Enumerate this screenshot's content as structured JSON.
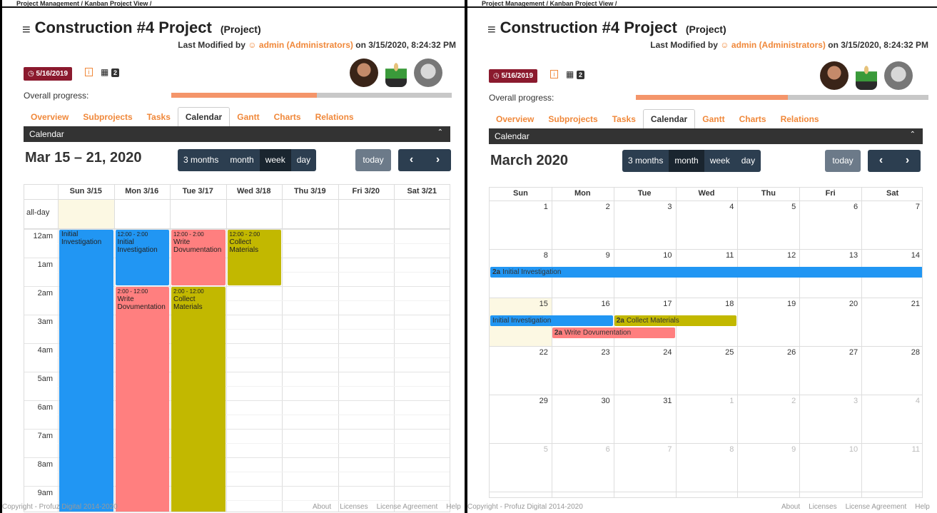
{
  "left": {
    "breadcrumb": "Project Management / Kanban Project View /",
    "title": "Construction #4 Project",
    "title_suffix": "(Project)",
    "modified_prefix": "Last Modified by",
    "modified_user": "admin (Administrators)",
    "modified_suffix": "on 3/15/2020, 8:24:32 PM",
    "date_badge": "5/16/2019",
    "grid_count": "2",
    "progress_label": "Overall progress:",
    "progress": 0.52,
    "tabs": [
      "Overview",
      "Subprojects",
      "Tasks",
      "Calendar",
      "Gantt",
      "Charts",
      "Relations"
    ],
    "active_tab": "Calendar",
    "calendar_header": "Calendar",
    "cal_title": "Mar 15 – 21, 2020",
    "view_buttons": [
      "3 months",
      "month",
      "week",
      "day"
    ],
    "active_view": "week",
    "today": "today",
    "day_headers": [
      "Sun 3/15",
      "Mon 3/16",
      "Tue 3/17",
      "Wed 3/18",
      "Thu 3/19",
      "Fri 3/20",
      "Sat 3/21"
    ],
    "all_day": "all-day",
    "hours": [
      "12am",
      "1am",
      "2am",
      "3am",
      "4am",
      "5am",
      "6am",
      "7am",
      "8am",
      "9am"
    ],
    "events": [
      {
        "day": 0,
        "start": 0,
        "end": 10,
        "time": "",
        "title": "Initial Investigation",
        "color": "#2196f3"
      },
      {
        "day": 1,
        "start": 0,
        "end": 2,
        "time": "12:00 - 2:00",
        "title": "Initial Investigation",
        "color": "#2196f3"
      },
      {
        "day": 2,
        "start": 0,
        "end": 2,
        "time": "12:00 - 2:00",
        "title": "Write Dovumentation",
        "color": "#ff7f7f"
      },
      {
        "day": 3,
        "start": 0,
        "end": 2,
        "time": "12:00 - 2:00",
        "title": "Collect Materials",
        "color": "#c2b800"
      },
      {
        "day": 1,
        "start": 2,
        "end": 10,
        "time": "2:00 - 12:00",
        "title": "Write Dovumentation",
        "color": "#ff7f7f"
      },
      {
        "day": 2,
        "start": 2,
        "end": 10,
        "time": "2:00 - 12:00",
        "title": "Collect Materials",
        "color": "#c2b800"
      }
    ],
    "footer": "Copyright - Profuz Digital 2014-2020",
    "footer_links": [
      "About",
      "Licenses",
      "License Agreement",
      "Help"
    ]
  },
  "right": {
    "breadcrumb": "Project Management / Kanban Project View /",
    "title": "Construction #4 Project",
    "title_suffix": "(Project)",
    "modified_prefix": "Last Modified by",
    "modified_user": "admin (Administrators)",
    "modified_suffix": "on 3/15/2020, 8:24:32 PM",
    "date_badge": "5/16/2019",
    "grid_count": "2",
    "progress_label": "Overall progress:",
    "progress": 0.52,
    "tabs": [
      "Overview",
      "Subprojects",
      "Tasks",
      "Calendar",
      "Gantt",
      "Charts",
      "Relations"
    ],
    "active_tab": "Calendar",
    "calendar_header": "Calendar",
    "cal_title": "March 2020",
    "view_buttons": [
      "3 months",
      "month",
      "week",
      "day"
    ],
    "active_view": "month",
    "today": "today",
    "day_headers": [
      "Sun",
      "Mon",
      "Tue",
      "Wed",
      "Thu",
      "Fri",
      "Sat"
    ],
    "weeks": [
      [
        "1",
        "2",
        "3",
        "4",
        "5",
        "6",
        "7"
      ],
      [
        "8",
        "9",
        "10",
        "11",
        "12",
        "13",
        "14"
      ],
      [
        "15",
        "16",
        "17",
        "18",
        "19",
        "20",
        "21"
      ],
      [
        "22",
        "23",
        "24",
        "25",
        "26",
        "27",
        "28"
      ],
      [
        "29",
        "30",
        "31",
        "1",
        "2",
        "3",
        "4"
      ],
      [
        "5",
        "6",
        "7",
        "8",
        "9",
        "10",
        "11"
      ]
    ],
    "month_events": [
      {
        "week": 1,
        "startDay": 0,
        "endDay": 6,
        "row": 0,
        "time": "2a",
        "title": "Initial Investigation",
        "color": "#2196f3"
      },
      {
        "week": 2,
        "startDay": 0,
        "endDay": 1,
        "row": 0,
        "time": "",
        "title": "Initial Investigation",
        "color": "#2196f3"
      },
      {
        "week": 2,
        "startDay": 2,
        "endDay": 3,
        "row": 0,
        "time": "2a",
        "title": "Collect Materials",
        "color": "#c2b800"
      },
      {
        "week": 2,
        "startDay": 1,
        "endDay": 2,
        "row": 1,
        "time": "2a",
        "title": "Write Dovumentation",
        "color": "#ff7f7f"
      }
    ],
    "footer": "Copyright - Profuz Digital 2014-2020",
    "footer_links": [
      "About",
      "Licenses",
      "License Agreement",
      "Help"
    ]
  }
}
